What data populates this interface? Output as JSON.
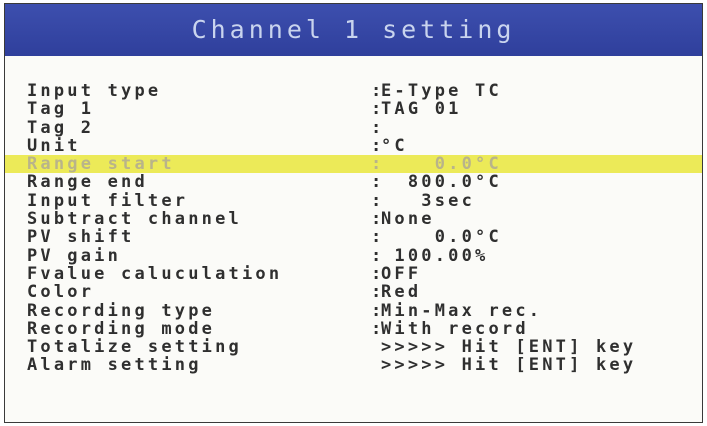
{
  "screen": {
    "title": "Channel 1 setting"
  },
  "rows": [
    {
      "label": "Input type",
      "sep": ":",
      "value": "E-Type TC"
    },
    {
      "label": "Tag 1",
      "sep": ":",
      "value": "TAG 01"
    },
    {
      "label": "Tag 2",
      "sep": ":",
      "value": ""
    },
    {
      "label": "Unit",
      "sep": ":",
      "value": "°C"
    },
    {
      "label": "Range start",
      "sep": ":",
      "value": "    0.0°C",
      "selected": true
    },
    {
      "label": "Range end",
      "sep": ":",
      "value": "  800.0°C"
    },
    {
      "label": "Input filter",
      "sep": ":",
      "value": "   3sec"
    },
    {
      "label": "Subtract channel",
      "sep": ":",
      "value": "None"
    },
    {
      "label": "PV shift",
      "sep": ":",
      "value": "    0.0°C"
    },
    {
      "label": "PV gain",
      "sep": ":",
      "value": " 100.00%"
    },
    {
      "label": "Fvalue caluculation",
      "sep": ":",
      "value": "OFF"
    },
    {
      "label": "Color",
      "sep": ":",
      "value": "Red"
    },
    {
      "label": "Recording type",
      "sep": ":",
      "value": "Min-Max rec."
    },
    {
      "label": "Recording mode",
      "sep": ":",
      "value": "With record"
    },
    {
      "label": "Totalize setting",
      "sep": "",
      "value": ">>>>> Hit [ENT] key"
    },
    {
      "label": "Alarm setting",
      "sep": "",
      "value": ">>>>> Hit [ENT] key"
    }
  ],
  "colors": {
    "titlebar": "#3246a6",
    "title_text": "#c9d4ee",
    "highlight": "#ecea58",
    "text": "#2f2f2f"
  }
}
